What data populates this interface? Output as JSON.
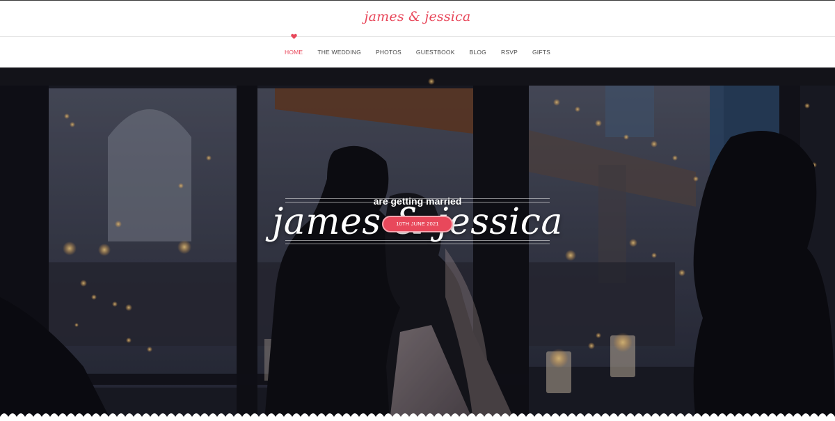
{
  "header": {
    "logo_text": "james & jessica"
  },
  "nav": {
    "items": [
      {
        "label": "HOME",
        "active": true
      },
      {
        "label": "THE WEDDING",
        "active": false
      },
      {
        "label": "PHOTOS",
        "active": false
      },
      {
        "label": "GUESTBOOK",
        "active": false
      },
      {
        "label": "BLOG",
        "active": false
      },
      {
        "label": "RSVP",
        "active": false
      },
      {
        "label": "GIFTS",
        "active": false
      }
    ],
    "active_indicator_icon": "heart-icon"
  },
  "hero": {
    "title": "james & jessica",
    "subtitle": "are getting married",
    "date_button": "10TH JUNE 2021",
    "background_subject": "couple silhouette in front of window with city bridge lights"
  },
  "colors": {
    "accent": "#e8485b",
    "nav_text": "#4a4a4a",
    "hero_text": "#ffffff"
  }
}
